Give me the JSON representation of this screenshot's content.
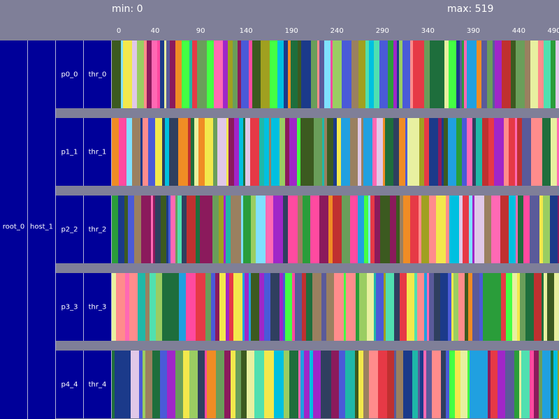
{
  "chart_data": {
    "type": "timeline",
    "min_label": "min: 0",
    "max_label": "max: 519",
    "xlim": [
      0,
      519
    ],
    "x_ticks": [
      0,
      40,
      90,
      140,
      190,
      240,
      290,
      340,
      390,
      440,
      490
    ],
    "tree": {
      "root": "root_0",
      "host": "host_1",
      "rows": [
        {
          "process": "p0_0",
          "thread": "thr_0"
        },
        {
          "process": "p1_1",
          "thread": "thr_1"
        },
        {
          "process": "p2_2",
          "thread": "thr_2"
        },
        {
          "process": "p3_3",
          "thread": "thr_3"
        },
        {
          "process": "p4_4",
          "thread": "thr_4"
        }
      ]
    },
    "palette": [
      "#2a9d3a",
      "#e63946",
      "#4a5ad8",
      "#f3e84c",
      "#1fb8a8",
      "#8b1a5c",
      "#9acd62",
      "#ff69b4",
      "#1b3a8a",
      "#f08c24",
      "#6a9e5a",
      "#7fe0ff",
      "#a026c8",
      "#2f3f5f",
      "#e0c8e8",
      "#20a0e0",
      "#44ff44",
      "#c03030",
      "#9a8060",
      "#1e6e3c",
      "#ff4aa0",
      "#50e0b0",
      "#a0a020",
      "#5a5a9a",
      "#e8f0a0",
      "#3c5a20",
      "#ff8c8c",
      "#00c0e0"
    ],
    "seed": 17
  }
}
